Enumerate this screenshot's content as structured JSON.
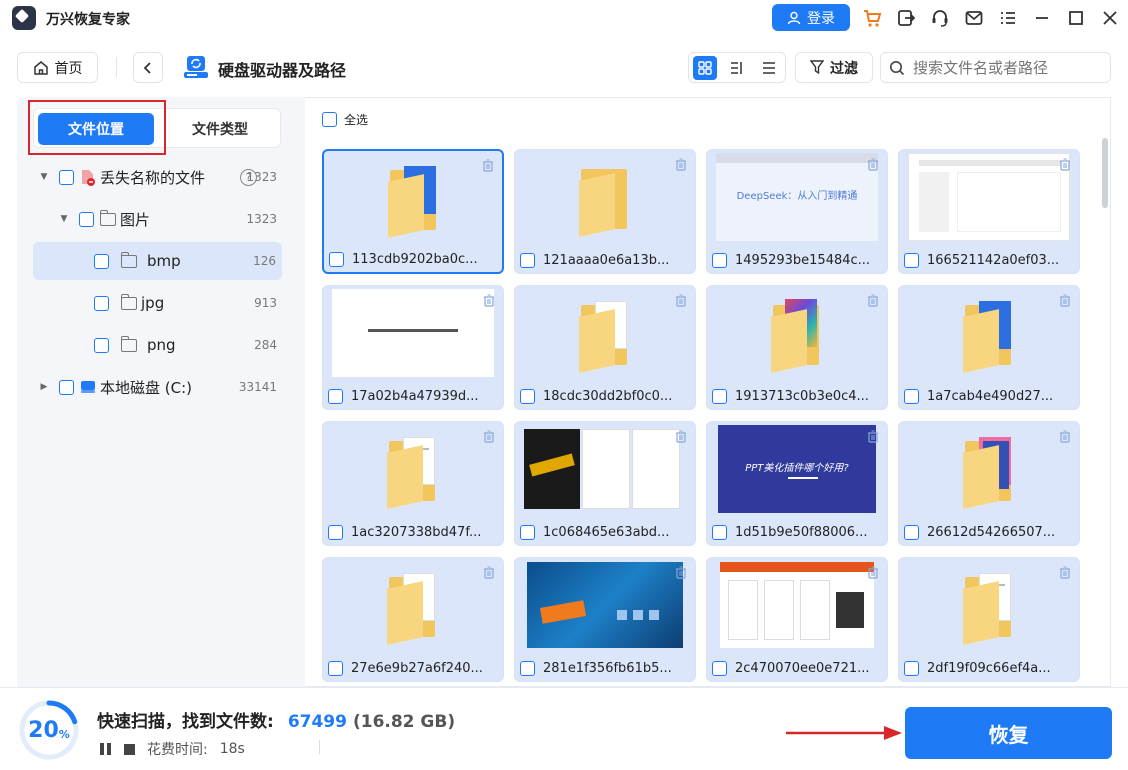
{
  "app": {
    "title": "万兴恢复专家"
  },
  "titlebar": {
    "login_label": "登录"
  },
  "toolbar": {
    "home_label": "首页",
    "page_title": "硬盘驱动器及路径",
    "filter_label": "过滤",
    "search_placeholder": "搜索文件名或者路径"
  },
  "left_panel": {
    "tabs": [
      "文件位置",
      "文件类型"
    ],
    "tree": [
      {
        "label": "丢失名称的文件",
        "count": "1323"
      },
      {
        "label": "图片",
        "count": "1323"
      },
      {
        "label": "bmp",
        "count": "126"
      },
      {
        "label": "jpg",
        "count": "913"
      },
      {
        "label": "png",
        "count": "284"
      },
      {
        "label": "本地磁盘 (C:)",
        "count": "33141"
      }
    ]
  },
  "main": {
    "select_all_label": "全选",
    "files": [
      {
        "name": "113cdb9202ba0c...",
        "thumb": "folder-doc-blue"
      },
      {
        "name": "121aaaa0e6a13b...",
        "thumb": "folder-plain"
      },
      {
        "name": "1495293be15484c...",
        "thumb": "deepseek-slide"
      },
      {
        "name": "166521142a0ef03...",
        "thumb": "document"
      },
      {
        "name": "17a02b4a47939d...",
        "thumb": "white-page"
      },
      {
        "name": "18cdc30dd2bf0c0...",
        "thumb": "folder-doc-green"
      },
      {
        "name": "1913713c0b3e0c4...",
        "thumb": "folder-colorful"
      },
      {
        "name": "1a7cab4e490d27...",
        "thumb": "folder-doc-blue"
      },
      {
        "name": "1ac3207338bd47f...",
        "thumb": "folder-doc-white"
      },
      {
        "name": "1c068465e63abd...",
        "thumb": "dark-poster"
      },
      {
        "name": "1d51b9e50f88006...",
        "thumb": "ppt-slide"
      },
      {
        "name": "26612d54266507...",
        "thumb": "folder-doc-pink"
      },
      {
        "name": "27e6e9b27a6f240...",
        "thumb": "folder-doc-green"
      },
      {
        "name": "281e1f356fb61b5...",
        "thumb": "tech-banner"
      },
      {
        "name": "2c470070ee0e721...",
        "thumb": "web-page"
      },
      {
        "name": "2df19f09c66ef4a...",
        "thumb": "folder-doc-white"
      }
    ],
    "thumb_text": {
      "deepseek": "DeepSeek：从入门到精通",
      "ppt": "PPT美化插件哪个好用?"
    }
  },
  "bottom": {
    "progress_percent": "20",
    "progress_unit": "%",
    "progress_value": 0.2,
    "scan_label": "快速扫描，找到文件数:",
    "scan_count": "67499",
    "scan_size": "(16.82 GB)",
    "elapsed_label": "花费时间:",
    "elapsed_value": "18s",
    "recover_label": "恢复"
  },
  "colors": {
    "accent": "#1f7bf5",
    "highlight_red": "#d9262a",
    "card_bg": "#dbe6fb"
  }
}
